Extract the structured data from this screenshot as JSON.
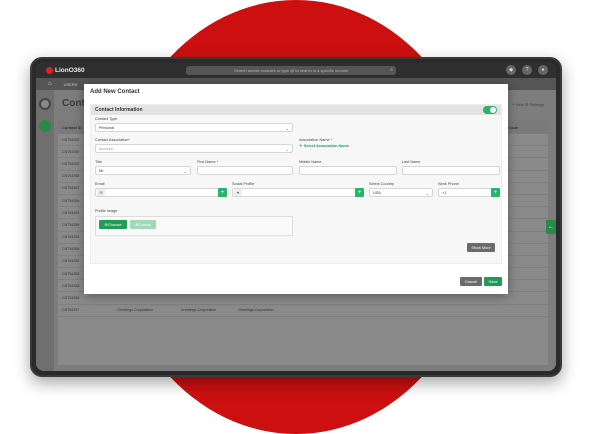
{
  "app": {
    "logo": "LionO360",
    "search_placeholder": "Search across modules or type @ to search in a specific module",
    "nav_label": "USERS"
  },
  "background": {
    "page_title": "Conta",
    "actions": "+ New   ⚙ Settings",
    "table_header": {
      "left": "Contact ID",
      "right": "Postal Code"
    },
    "rows": [
      "CNT54350",
      "CNT54350",
      "CNT54350",
      "CNT54358",
      "CNT54367",
      "CNT54356",
      "CNT54353",
      "CNT54359",
      "CNT54354",
      "CNT54358",
      "CNT54350",
      "CNT54350",
      "CNT54358",
      "CNT54358"
    ],
    "last_row": [
      "CNT54357",
      "Greetings Corporation",
      "Greetings Corporation",
      "Greetings Corporation"
    ]
  },
  "modal": {
    "title": "Add New Contact",
    "section": "Contact Information",
    "contact_type": {
      "label": "Contact Type",
      "value": "Personal"
    },
    "contact_association": {
      "label": "Contact Association*",
      "placeholder": "Account"
    },
    "association_name": {
      "label": "Association Name *",
      "link": "Select Association Name"
    },
    "title_field": {
      "label": "Title",
      "value": "Mr"
    },
    "first_name": {
      "label": "First Name *"
    },
    "middle_name": {
      "label": "Middle Name"
    },
    "last_name": {
      "label": "Last Name"
    },
    "email": {
      "label": "Email"
    },
    "social_profile": {
      "label": "Social Profile"
    },
    "select_country": {
      "label": "Select Country",
      "value": "USA"
    },
    "work_phone": {
      "label": "Work Phone",
      "value": "+1"
    },
    "profile_image": {
      "label": "Profile Image",
      "choose": "Choose",
      "cancel": "Cancel"
    },
    "show_more": "Show More",
    "footer": {
      "cancel": "Cancel",
      "save": "Save"
    }
  },
  "colors": {
    "accent": "#1f9d57",
    "brand_red": "#cc1010"
  }
}
